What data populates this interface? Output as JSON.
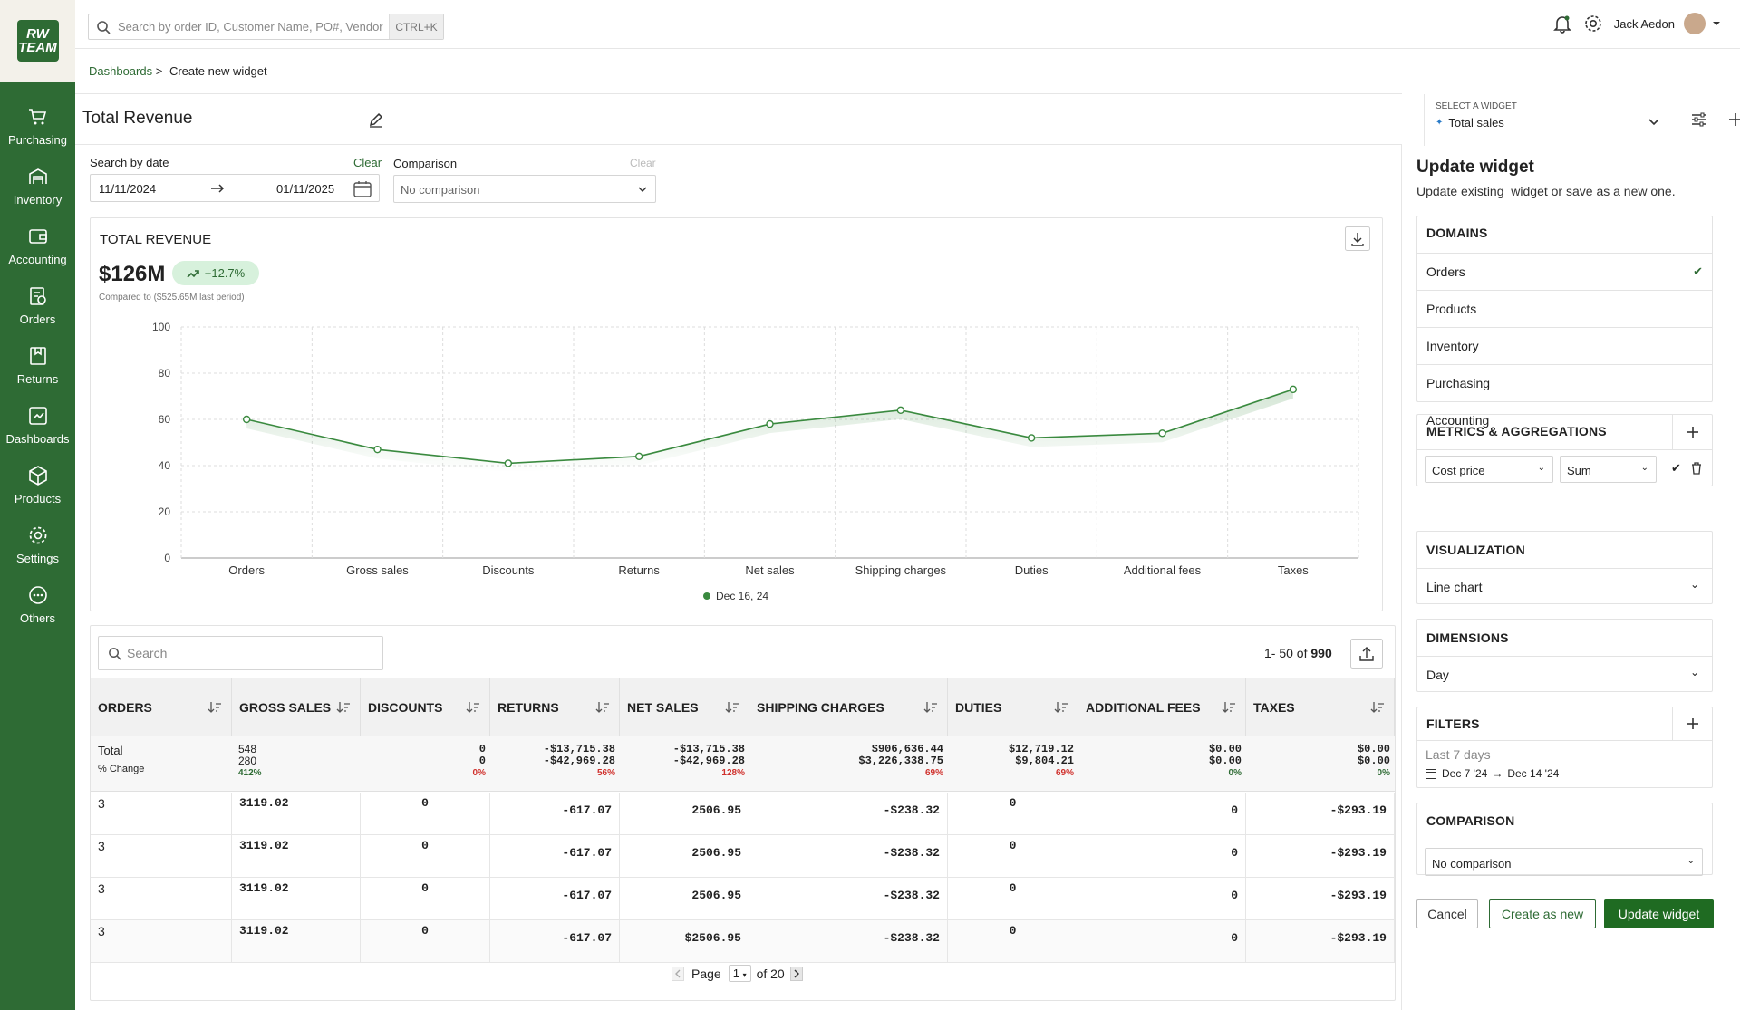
{
  "brand": {
    "logo_line1": "RW",
    "logo_line2": "TEAM"
  },
  "nav": [
    {
      "label": "Purchasing",
      "icon": "cart-icon"
    },
    {
      "label": "Inventory",
      "icon": "warehouse-icon"
    },
    {
      "label": "Accounting",
      "icon": "wallet-icon"
    },
    {
      "label": "Orders",
      "icon": "orders-icon"
    },
    {
      "label": "Returns",
      "icon": "returns-icon"
    },
    {
      "label": "Dashboards",
      "icon": "dashboard-icon"
    },
    {
      "label": "Products",
      "icon": "box-icon"
    },
    {
      "label": "Settings",
      "icon": "gear-icon"
    },
    {
      "label": "Others",
      "icon": "more-icon"
    }
  ],
  "topbar": {
    "search_placeholder": "Search by order ID, Customer Name, PO#, Vendor",
    "shortcut": "CTRL+K",
    "user_name": "Jack Aedon"
  },
  "breadcrumb": {
    "parent": "Dashboards",
    "separator": ">",
    "current": "Create new widget"
  },
  "page": {
    "title": "Total Revenue"
  },
  "widget_select": {
    "label": "SELECT A WIDGET",
    "value": "Total sales"
  },
  "date_filter": {
    "label": "Search by date",
    "clear": "Clear",
    "from": "11/11/2024",
    "to": "01/11/2025"
  },
  "comparison_filter": {
    "label": "Comparison",
    "clear": "Clear",
    "value": "No comparison"
  },
  "summary": {
    "title": "TOTAL REVENUE",
    "value": "$126M",
    "change": "+12.7%",
    "compared": "Compared to ($525.65M last period)"
  },
  "chart_data": {
    "type": "line",
    "categories": [
      "Orders",
      "Gross sales",
      "Discounts",
      "Returns",
      "Net sales",
      "Shipping charges",
      "Duties",
      "Additional fees",
      "Taxes"
    ],
    "series": [
      {
        "name": "Dec 16, 24",
        "values": [
          60,
          47,
          41,
          44,
          58,
          64,
          52,
          54,
          73
        ]
      }
    ],
    "ylim": [
      0,
      100
    ],
    "yticks": [
      0,
      20,
      40,
      60,
      80,
      100
    ],
    "grid": true,
    "legend": "bottom",
    "color": "#3a8a3f"
  },
  "table": {
    "search_placeholder": "Search",
    "range": "1- 50 of",
    "total": "990",
    "columns": [
      "ORDERS",
      "GROSS SALES",
      "DISCOUNTS",
      "RETURNS",
      "NET SALES",
      "SHIPPING CHARGES",
      "DUTIES",
      "ADDITIONAL FEES",
      "TAXES"
    ],
    "total_row": {
      "label": "Total",
      "change_label": "% Change",
      "gross": [
        "548",
        "280",
        "412%"
      ],
      "discounts": [
        "0",
        "0",
        "0%"
      ],
      "returns": [
        "-$13,715.38",
        "-$42,969.28",
        "56%"
      ],
      "net": [
        "-$13,715.38",
        "-$42,969.28",
        "128%"
      ],
      "shipping": [
        "$906,636.44",
        "$3,226,338.75",
        "69%"
      ],
      "duties": [
        "$12,719.12",
        "$9,804.21",
        "69%"
      ],
      "fees": [
        "$0.00",
        "$0.00",
        "0%"
      ],
      "taxes": [
        "$0.00",
        "$0.00",
        "0%"
      ]
    },
    "rows": [
      [
        "3",
        "3119.02",
        "0",
        "-617.07",
        "2506.95",
        "-$238.32",
        "0",
        "0",
        "-$293.19"
      ],
      [
        "3",
        "3119.02",
        "0",
        "-617.07",
        "2506.95",
        "-$238.32",
        "0",
        "0",
        "-$293.19"
      ],
      [
        "3",
        "3119.02",
        "0",
        "-617.07",
        "2506.95",
        "-$238.32",
        "0",
        "0",
        "-$293.19"
      ],
      [
        "3",
        "3119.02",
        "0",
        "-617.07",
        "$2506.95",
        "-$238.32",
        "0",
        "0",
        "-$293.19"
      ]
    ],
    "pagination": {
      "page_label": "Page",
      "page": "1",
      "of": "of 20"
    }
  },
  "panel": {
    "title": "Update widget",
    "subtitle": "Update existing  widget or save as a new one.",
    "domains_h": "DOMAINS",
    "domains": [
      "Orders",
      "Products",
      "Inventory",
      "Purchasing",
      "Accounting"
    ],
    "metrics_h": "METRICS & AGGREGATIONS",
    "metric": "Cost price",
    "agg": "Sum",
    "viz_h": "VISUALIZATION",
    "viz": "Line chart",
    "dim_h": "DIMENSIONS",
    "dim": "Day",
    "filters_h": "FILTERS",
    "filter_name": "Last 7 days",
    "filter_from": "Dec 7 '24",
    "filter_to": "Dec 14 '24",
    "comp_h": "COMPARISON",
    "comp": "No comparison",
    "cancel": "Cancel",
    "create": "Create as new",
    "update": "Update widget"
  }
}
